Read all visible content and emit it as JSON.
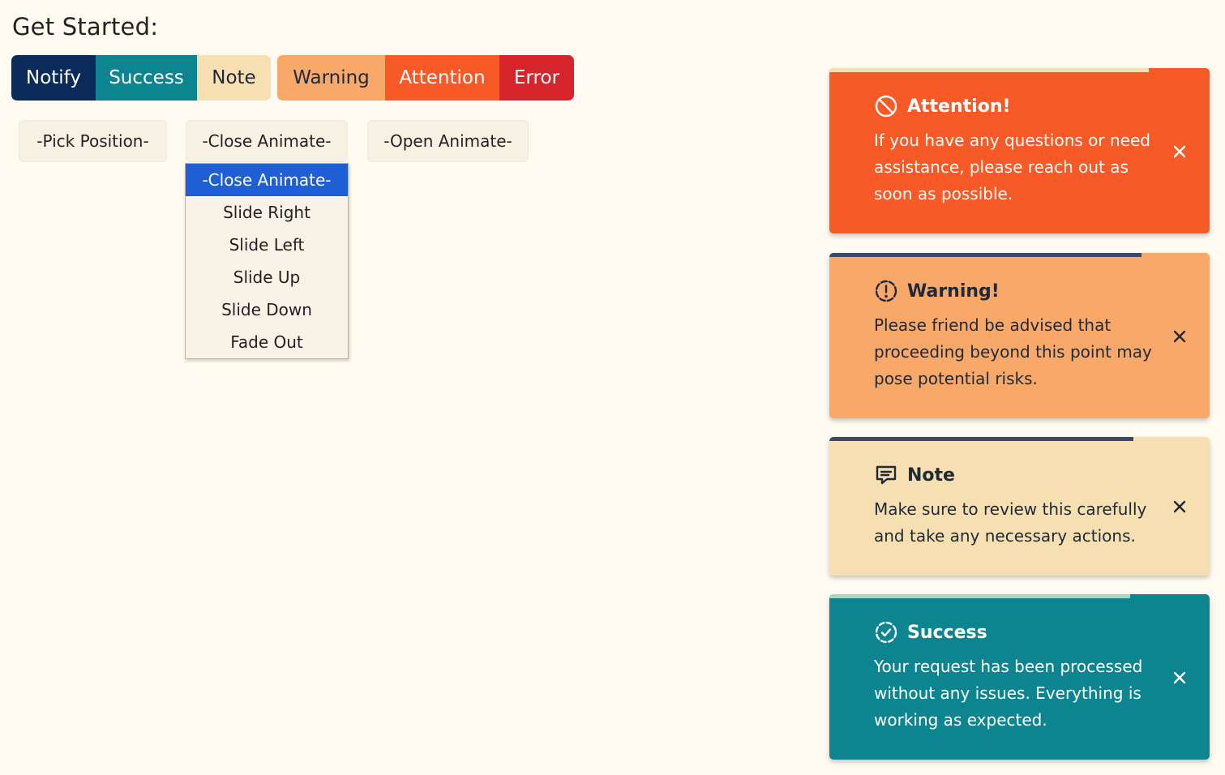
{
  "heading": "Get Started:",
  "buttons": [
    {
      "label": "Notify",
      "bg": "#0a2a5a",
      "fg": "#ffffff"
    },
    {
      "label": "Success",
      "bg": "#0d8590",
      "fg": "#ffffff"
    },
    {
      "label": "Note",
      "bg": "#f6dfb1",
      "fg": "#1f2937"
    },
    {
      "label": "Warning",
      "bg": "#f8a868",
      "fg": "#1f2937"
    },
    {
      "label": "Attention",
      "bg": "#f75a26",
      "fg": "#ffffff"
    },
    {
      "label": "Error",
      "bg": "#d5252b",
      "fg": "#ffffff"
    }
  ],
  "selects": {
    "position": "-Pick Position-",
    "close_animate": "-Close Animate-",
    "open_animate": "-Open Animate-"
  },
  "dropdown_options": [
    "-Close Animate-",
    "Slide Right",
    "Slide Left",
    "Slide Up",
    "Slide Down",
    "Fade Out"
  ],
  "dropdown_selected": "-Close Animate-",
  "toasts": [
    {
      "type": "attention",
      "icon": "no-entry-icon",
      "title": "Attention!",
      "message": "If you have any questions or need assistance, please reach out as soon as possible.",
      "bg": "#f75a26",
      "fg": "#ffffff",
      "progress_color": "#f6dfb1",
      "progress": 0.84
    },
    {
      "type": "warning",
      "icon": "exclamation-circle-icon",
      "title": "Warning!",
      "message": "Please friend be advised that proceeding beyond this point may pose potential risks.",
      "bg": "#f8a868",
      "fg": "#1f2937",
      "progress_color": "#394a66",
      "progress": 0.82
    },
    {
      "type": "note",
      "icon": "message-icon",
      "title": "Note",
      "message": "Make sure to review this carefully and take any necessary actions.",
      "bg": "#f6dfb1",
      "fg": "#1f2937",
      "progress_color": "#394a66",
      "progress": 0.8
    },
    {
      "type": "success",
      "icon": "check-circle-icon",
      "title": "Success",
      "message": "Your request has been processed without any issues. Everything is working as expected.",
      "bg": "#0d8590",
      "fg": "#ffffff",
      "progress_color": "#a7d7c4",
      "progress": 0.79
    }
  ]
}
